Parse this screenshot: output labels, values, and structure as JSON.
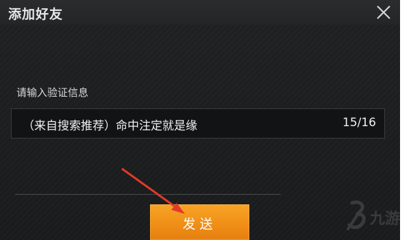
{
  "dialog": {
    "title": "添加好友",
    "close_icon": "close-icon"
  },
  "form": {
    "prompt_label": "请输入验证信息",
    "message_value": "（来自搜索推荐）命中注定就是缘",
    "char_count": "15/16"
  },
  "actions": {
    "send_label": "发送"
  },
  "colors": {
    "panel_bg": "#1d1f20",
    "send_button": "#f08f17",
    "annotation_arrow": "#e23a2a"
  },
  "watermark": {
    "logo_text": "九游"
  }
}
